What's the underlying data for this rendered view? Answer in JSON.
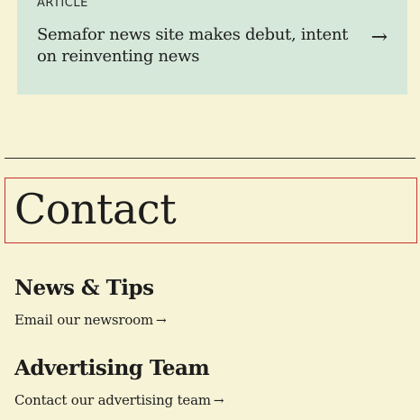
{
  "article_card": {
    "kicker": "ARTICLE",
    "title": "Semafor news site makes debut, intent on reinventing news",
    "arrow_icon": "arrow-right-icon",
    "arrow_glyph": "→",
    "background": "#d6e8da"
  },
  "contact": {
    "heading": "Contact"
  },
  "news_tips": {
    "heading": "News & Tips",
    "link_label": "Email our newsroom",
    "link_arrow": "→"
  },
  "advertising": {
    "heading": "Advertising Team",
    "link_label": "Contact our advertising team",
    "link_arrow": "→"
  },
  "colors": {
    "page_background": "#f7f3d7",
    "highlight_border": "#c8312d",
    "text": "#1d1d1d"
  }
}
